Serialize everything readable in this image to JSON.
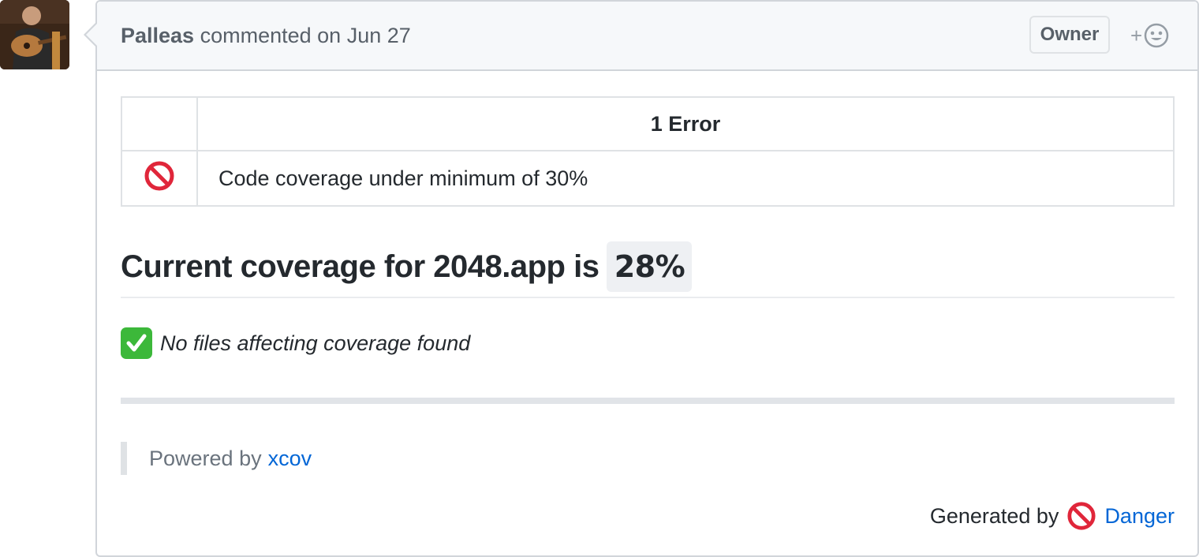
{
  "comment": {
    "author": "Palleas",
    "action": "commented on Jun 27",
    "badge": "Owner",
    "reaction_plus": "+"
  },
  "errors_table": {
    "header": "1 Error",
    "rows": [
      {
        "icon": "no-entry-icon",
        "message": "Code coverage under minimum of 30%"
      }
    ]
  },
  "coverage": {
    "heading": "Current coverage for 2048.app is",
    "value": "28%"
  },
  "files_note": {
    "icon": "check-mark-button-icon",
    "text": "No files affecting coverage found"
  },
  "powered": {
    "prefix": "Powered by",
    "link": "xcov"
  },
  "generated": {
    "prefix": "Generated by",
    "icon": "no-entry-icon",
    "link": "Danger"
  },
  "colors": {
    "link": "#0366d6",
    "no_entry": "#e0263a",
    "check": "#3cb83a"
  }
}
